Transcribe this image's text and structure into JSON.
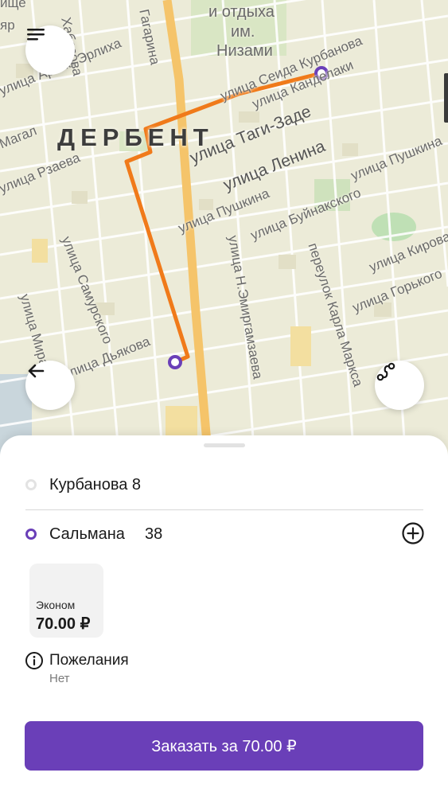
{
  "map": {
    "city": "ДЕРБЕНТ",
    "park_label_lines": [
      "и отдыха",
      "им.",
      "Низами"
    ],
    "streets": [
      "улица Арона Эрлиха",
      "улица Сеида Курбанова",
      "улица Канделаки",
      "улица Таги-Заде",
      "улица Ленина",
      "улица Пушкина",
      "улица Буйнакского",
      "переулок Карла Маркса",
      "улица Н.Эмиргамзаева",
      "улица Самурского",
      "улица Мира",
      "улица Дьякова",
      "улица Рзаева",
      "Магал",
      "улица Кирова",
      "улица Горького",
      "Гагарина",
      "Хабазова",
      "улица Пушкина",
      "ище",
      "яр"
    ],
    "route_color": "#f07a1a",
    "marker_color": "#6a3fb8"
  },
  "sheet": {
    "from_address": "Курбанова 8",
    "to_address": "Сальмана",
    "to_house": "38",
    "tariff": {
      "name": "Эконом",
      "price": "70.00 ₽"
    },
    "wishes": {
      "title": "Пожелания",
      "value": "Нет"
    },
    "order_button": "Заказать за 70.00 ₽"
  },
  "colors": {
    "accent": "#6a3fb8",
    "route": "#f07a1a"
  }
}
